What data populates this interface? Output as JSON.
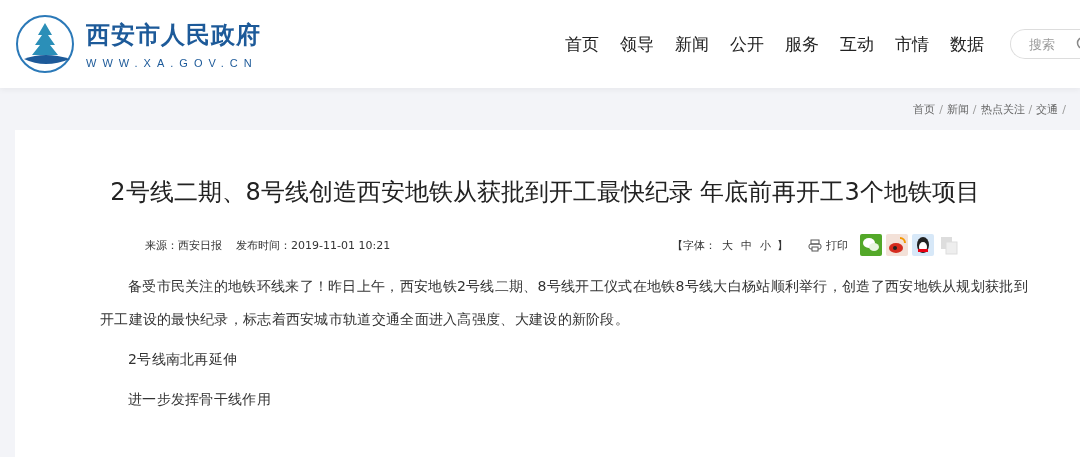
{
  "header": {
    "site_name": "西安市人民政府",
    "site_url": "WWW.XA.GOV.CN",
    "nav": [
      {
        "label": "首页"
      },
      {
        "label": "领导"
      },
      {
        "label": "新闻"
      },
      {
        "label": "公开"
      },
      {
        "label": "服务"
      },
      {
        "label": "互动"
      },
      {
        "label": "市情"
      },
      {
        "label": "数据"
      }
    ],
    "search": {
      "placeholder": "搜索"
    }
  },
  "breadcrumb": [
    {
      "label": "首页",
      "separator": "/"
    },
    {
      "label": "新闻",
      "separator": "/"
    },
    {
      "label": "热点关注",
      "separator": "/"
    },
    {
      "label": "交通",
      "separator": "/"
    }
  ],
  "article": {
    "title": "2号线二期、8号线创造西安地铁从获批到开工最快纪录 年底前再开工3个地铁项目",
    "source": "来源：西安日报",
    "published": "发布时间：2019-11-01 10:21",
    "font_size": {
      "label": "【字体：",
      "options": [
        "大",
        "中",
        "小"
      ],
      "end": "】"
    },
    "print": "打印",
    "share": [
      {
        "kind": "wechat"
      },
      {
        "kind": "weibo"
      },
      {
        "kind": "qq"
      },
      {
        "kind": "copy"
      }
    ],
    "paragraphs": [
      "备受市民关注的地铁环线来了！昨日上午，西安地铁2号线二期、8号线开工仪式在地铁8号线大白杨站顺利举行，创造了西安地铁从规划获批到开工建设的最快纪录，标志着西安城市轨道交通全面进入高强度、大建设的新阶段。",
      "2号线南北再延伸",
      "进一步发挥骨干线作用"
    ]
  }
}
